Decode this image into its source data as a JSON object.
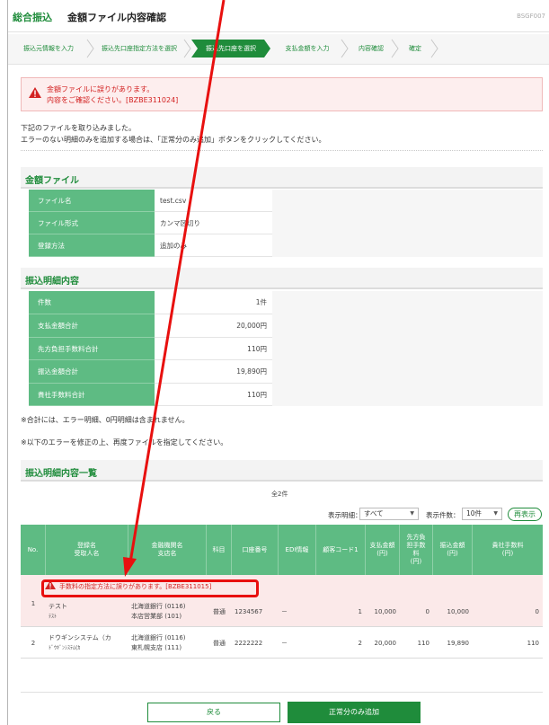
{
  "header": {
    "category": "総合振込",
    "title": "金額ファイル内容確認",
    "code": "BSGF007"
  },
  "steps": [
    {
      "label": "振込元情報を入力"
    },
    {
      "label": "振込先口座指定方法を選択"
    },
    {
      "label": "振込先口座を選択"
    },
    {
      "label": "支払金額を入力"
    },
    {
      "label": "内容確認"
    },
    {
      "label": "確定"
    }
  ],
  "error_box": {
    "line1": "金額ファイルに誤りがあります。",
    "line2": "内容をご確認ください。[BZBE311024]"
  },
  "message": {
    "line1": "下記のファイルを取り込みました。",
    "line2": "エラーのない明細のみを追加する場合は、「正常分のみ追加」ボタンをクリックしてください。"
  },
  "file_section": {
    "heading": "金額ファイル",
    "rows": [
      {
        "label": "ファイル名",
        "value": "test.csv"
      },
      {
        "label": "ファイル形式",
        "value": "カンマ区切り"
      },
      {
        "label": "登録方法",
        "value": "追加のみ"
      }
    ]
  },
  "detail_section": {
    "heading": "振込明細内容",
    "rows": [
      {
        "label": "件数",
        "value": "1件"
      },
      {
        "label": "支払金額合計",
        "value": "20,000円"
      },
      {
        "label": "先方負担手数料合計",
        "value": "110円"
      },
      {
        "label": "振込金額合計",
        "value": "19,890円"
      },
      {
        "label": "貴社手数料合計",
        "value": "110円"
      }
    ]
  },
  "notes": {
    "n1": "※合計には、エラー明細、0円明細は含まれません。",
    "n2": "※以下のエラーを修正の上、再度ファイルを指定してください。"
  },
  "list_section": {
    "heading": "振込明細内容一覧",
    "total": "全2件",
    "filter_label": "表示明細：",
    "filter_value": "すべて",
    "count_label": "表示件数：",
    "count_value": "10件",
    "redisplay": "再表示"
  },
  "table": {
    "headers": [
      {
        "l1": "No.",
        "l2": ""
      },
      {
        "l1": "登録名",
        "l2": "受取人名"
      },
      {
        "l1": "金融機関名",
        "l2": "支店名"
      },
      {
        "l1": "科目",
        "l2": ""
      },
      {
        "l1": "口座番号",
        "l2": ""
      },
      {
        "l1": "EDI情報",
        "l2": ""
      },
      {
        "l1": "顧客コード1",
        "l2": ""
      },
      {
        "l1": "支払金額",
        "l2": "(円)"
      },
      {
        "l1": "先方負担手数料",
        "l2": "(円)"
      },
      {
        "l1": "振込金額",
        "l2": "(円)"
      },
      {
        "l1": "貴社手数料",
        "l2": "(円)"
      }
    ],
    "error_row": "手数料の指定方法に誤りがあります。[BZBE311015]",
    "rows": [
      {
        "no": "1",
        "name1": "テスト",
        "name2": "ﾃｽﾄ",
        "bank1": "北海道銀行 (0116)",
        "bank2": "本店営業部 (101)",
        "type": "普通",
        "account": "1234567",
        "edi": "－",
        "customer": "1",
        "pay": "10,000",
        "fee": "0",
        "transfer": "10,000",
        "ourfee": "0"
      },
      {
        "no": "2",
        "name1": "ドウギンシステム（カ",
        "name2": "ﾄﾞｳｷﾞﾝｼｽﾃﾑ(ｶ",
        "bank1": "北海道銀行 (0116)",
        "bank2": "東札幌支店 (111)",
        "type": "普通",
        "account": "2222222",
        "edi": "－",
        "customer": "2",
        "pay": "20,000",
        "fee": "110",
        "transfer": "19,890",
        "ourfee": "110"
      }
    ]
  },
  "buttons": {
    "back": "戻る",
    "add": "正常分のみ追加"
  },
  "colors": {
    "brand": "#1f8c3b",
    "table_header": "#5ebb83",
    "error": "#d32222",
    "annotation": "#e8100f"
  }
}
